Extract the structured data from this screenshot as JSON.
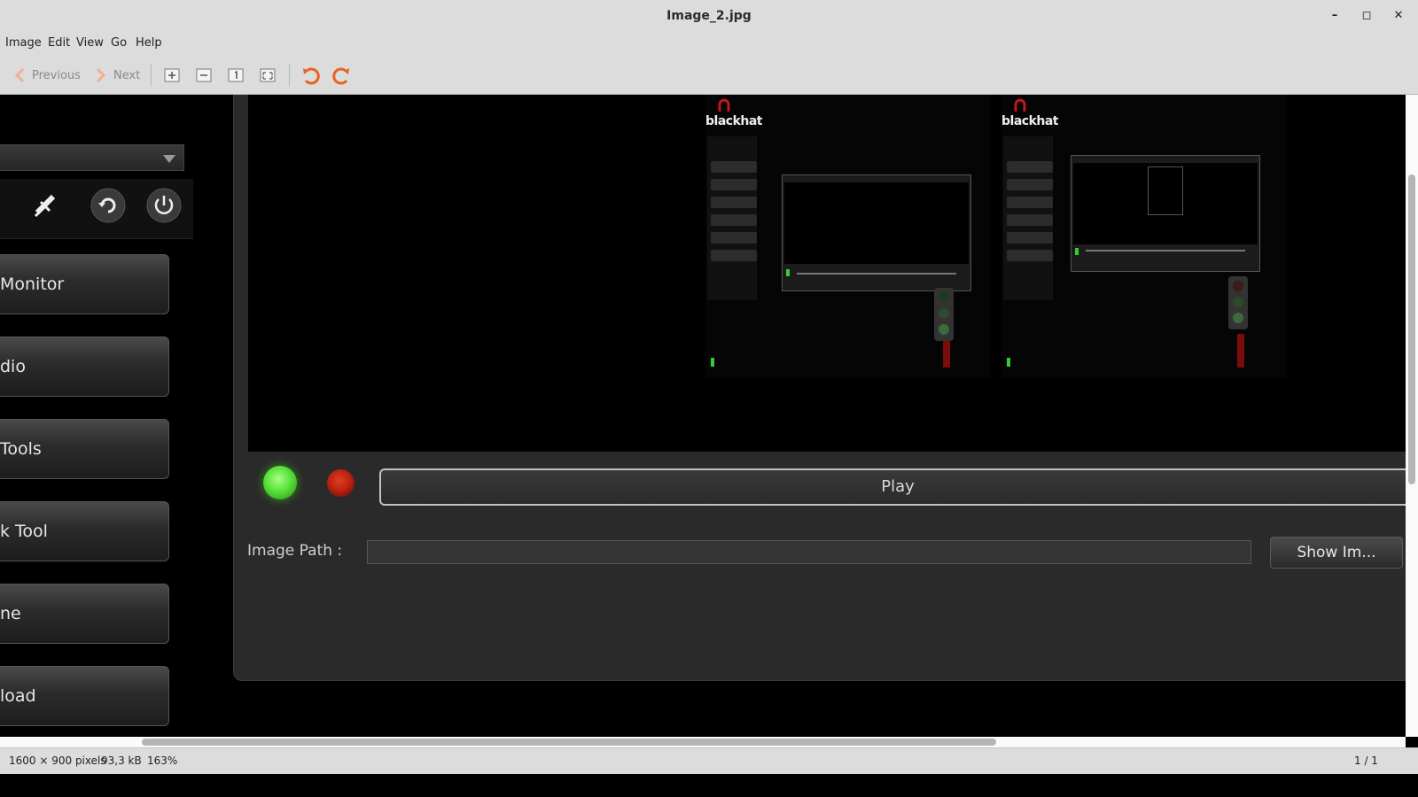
{
  "window": {
    "title": "Image_2.jpg",
    "minimize": "–",
    "maximize": "◻",
    "close": "✕"
  },
  "menu": {
    "items": [
      "Image",
      "Edit",
      "View",
      "Go",
      "Help"
    ]
  },
  "toolbar": {
    "previous_label": "Previous",
    "next_label": "Next",
    "icons": [
      "zoom-in-icon",
      "zoom-out-icon",
      "zoom-normal-icon",
      "zoom-fit-icon",
      "rotate-left-icon",
      "rotate-right-icon"
    ],
    "rotate_color": "#e8641e"
  },
  "content": {
    "side_buttons": [
      "Monitor",
      "dio",
      " Tools",
      "k Tool",
      "ne",
      "load"
    ],
    "play_label": "Play",
    "path_label": "Image Path :",
    "path_value": "",
    "show_label": "Show Im...",
    "thumb_brand": "blackhat",
    "led_green": "#58e23a",
    "led_red": "#b82010"
  },
  "status": {
    "dimensions": "1600 × 900 pixels",
    "size": "93,3 kB",
    "zoom": "163%",
    "page": "1 / 1"
  }
}
